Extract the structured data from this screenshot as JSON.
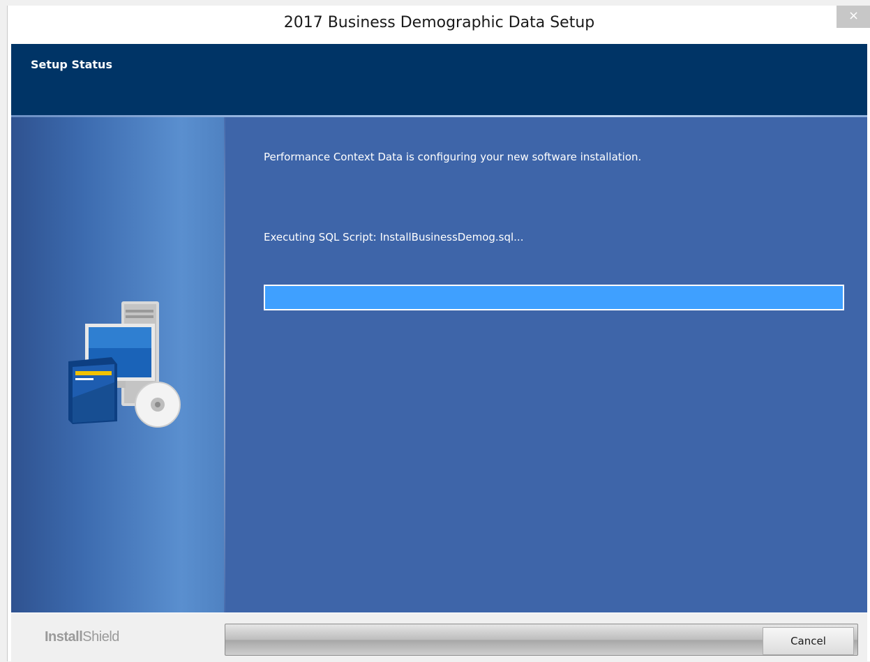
{
  "window": {
    "title": "2017 Business Demographic Data Setup",
    "close_glyph": "×"
  },
  "header": {
    "title": "Setup Status"
  },
  "main": {
    "status_line": "Performance Context Data is configuring your new software installation.",
    "action_line": "Executing SQL Script: InstallBusinessDemog.sql..."
  },
  "progress": {
    "percent": 100,
    "fill_color": "#3fa0ff"
  },
  "footer": {
    "brand_part1": "Install",
    "brand_part2": "Shield",
    "cancel_label": "Cancel"
  },
  "colors": {
    "header_bg": "#003466",
    "content_bg": "#3e65a9"
  },
  "icons": {
    "close": "close-icon",
    "illustration": "computer-setup-icon"
  }
}
